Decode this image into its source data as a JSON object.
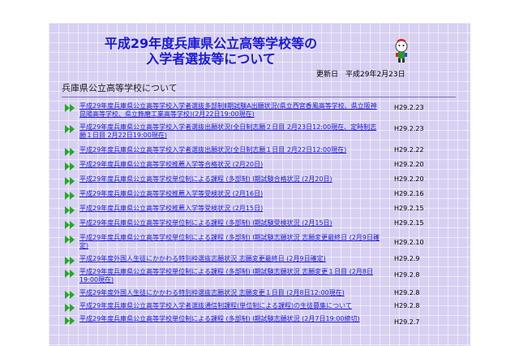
{
  "header": {
    "title_line1": "平成29年度兵庫県公立高等学校等の",
    "title_line2": "入学者選抜等について",
    "updated": "更新日　平成29年2月23日"
  },
  "section_title": "兵庫県公立高等学校について",
  "colors": {
    "link": "#1a1ad8",
    "bullet": "#22aa22",
    "background": "#d8d0f2"
  },
  "items": [
    {
      "text": "平成29年度兵庫県公立高等学校入学者選抜多部制Ⅱ期試験A出願状況(県立西宮香風高等学校、県立阪神昆陽高等学校、県立飾磨工業高等学校)(2月22日19:00現在)",
      "date": "H29.2.23"
    },
    {
      "text": "平成29年度兵庫県公立高等学校入学者選抜出願状況(全日制志願２日目 2月23日12:00現在、定時制志願１日目 2月22日19:00現在)",
      "date": "H29.2.23"
    },
    {
      "text": "平成29年度兵庫県公立高等学校入学者選抜出願状況(全日制志願１日目 2月22日12:00現在)",
      "date": "H29.2.22"
    },
    {
      "text": "平成29年度兵庫県公立高等学校推薦入学等合格状況 (2月20日)",
      "date": "H29.2.20"
    },
    {
      "text": "平成29年度兵庫県公立高等学校単位制による課程 (多部制) Ⅰ期試験合格状況 (2月20日)",
      "date": "H29.2.20"
    },
    {
      "text": "平成29年度兵庫県公立高等学校推薦入学等受検状況 (2月16日)",
      "date": "H29.2.16"
    },
    {
      "text": "平成29年度兵庫県公立高等学校推薦入学等受検状況 (2月15日)",
      "date": "H29.2.15"
    },
    {
      "text": "平成29年度兵庫県公立高等学校単位制による課程 (多部制) Ⅰ期試験受検状況 (2月15日)",
      "date": "H29.2.15"
    },
    {
      "text": "平成29年度兵庫県公立高等学校単位制による課程 (多部制) Ⅰ期試験志願状況 志願変更最終日 (2月9日確定)",
      "date": "H29.2.10"
    },
    {
      "text": "平成29年度外国人生徒にかかわる特別枠選抜志願状況 志願変更最終日 (2月9日確定)",
      "date": "H29.2.9"
    },
    {
      "text": "平成29年度兵庫県公立高等学校単位制による課程 (多部制) Ⅰ期試験志願状況 志願変更１日目 (2月8日19:00現在)",
      "date": "H29.2.8"
    },
    {
      "text": "平成29年度外国人生徒にかかわる特別枠選抜志願状況 志願変更１日目 (2月8日12:00現在)",
      "date": "H29.2.8"
    },
    {
      "text": "平成29年度兵庫県公立高等学校入学者選抜通信制課程(単位制による課程)の生徒募集について",
      "date": "H29.2.8"
    },
    {
      "text": "平成29年度兵庫県公立高等学校単位制による課程 (多部制) Ⅰ期試験志願状況 (2月7日19:00締切)",
      "date": "H29.2.7"
    }
  ]
}
